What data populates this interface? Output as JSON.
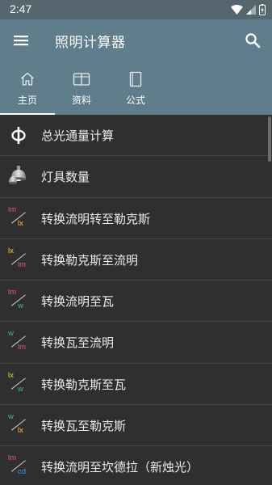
{
  "status": {
    "time": "2:47"
  },
  "app": {
    "title": "照明计算器"
  },
  "tabs": [
    {
      "label": "主页",
      "icon": "home-icon",
      "selected": true
    },
    {
      "label": "资料",
      "icon": "book-open-icon",
      "selected": false
    },
    {
      "label": "公式",
      "icon": "book-icon",
      "selected": false
    }
  ],
  "list": [
    {
      "label": "总光通量计算",
      "icon": "phi-icon"
    },
    {
      "label": "灯具数量",
      "icon": "lamp-icon"
    },
    {
      "label": "转换流明转至勒克斯",
      "icon": "lm-to-lx-icon",
      "top": "lm",
      "bottom": "lx",
      "top_color": "#e0559a",
      "bottom_color": "#ffd21a"
    },
    {
      "label": "转换勒克斯至流明",
      "icon": "lx-to-lm-icon",
      "top": "lx",
      "bottom": "lm",
      "top_color": "#ffd21a",
      "bottom_color": "#e0559a"
    },
    {
      "label": "转换流明至瓦",
      "icon": "lm-to-w-icon",
      "top": "lm",
      "bottom": "w",
      "top_color": "#e0559a",
      "bottom_color": "#3dbb8f"
    },
    {
      "label": "转换瓦至流明",
      "icon": "w-to-lm-icon",
      "top": "w",
      "bottom": "lm",
      "top_color": "#3dbb8f",
      "bottom_color": "#e0559a"
    },
    {
      "label": "转换勒克斯至瓦",
      "icon": "lx-to-w-icon",
      "top": "lx",
      "bottom": "w",
      "top_color": "#ffd21a",
      "bottom_color": "#3dbb8f"
    },
    {
      "label": "转换瓦至勒克斯",
      "icon": "w-to-lx-icon",
      "top": "w",
      "bottom": "lx",
      "top_color": "#3dbb8f",
      "bottom_color": "#ffd21a"
    },
    {
      "label": "转换流明至坎德拉（新烛光）",
      "icon": "lm-to-cd-icon",
      "top": "lm",
      "bottom": "cd",
      "top_color": "#e0559a",
      "bottom_color": "#3aa3e3"
    }
  ],
  "colors": {
    "appbar": "#607d8b",
    "statusbar": "#56666e",
    "background": "#2f2f2f"
  }
}
